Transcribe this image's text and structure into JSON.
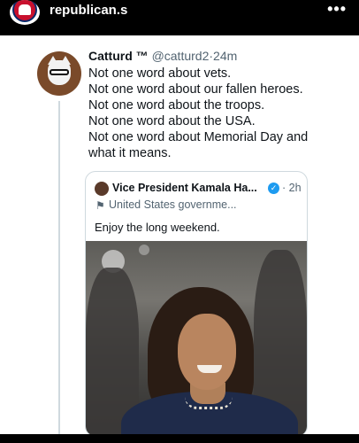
{
  "header": {
    "account_name": "republican.s",
    "more_icon": "more-horizontal-icon",
    "more_label": "•••",
    "logo_icon": "republican-elephant-logo"
  },
  "tweet": {
    "author_name": "Catturd ™",
    "author_handle": "@catturd2",
    "separator": "·",
    "time": "24m",
    "lines": [
      "Not one word about vets.",
      "Not one word about our fallen heroes.",
      "Not one word about the troops.",
      "Not one word about the USA.",
      "Not one word about Memorial Day and",
      "what it means."
    ]
  },
  "quoted_tweet": {
    "author_name": "Vice President Kamala Ha...",
    "verified": true,
    "time": "· 2h",
    "org_label": "United States governme...",
    "flag_icon": "flag-icon",
    "flag_glyph": "⚑",
    "verified_glyph": "✓",
    "text": "Enjoy the long weekend."
  },
  "colors": {
    "text_primary": "#0f1419",
    "text_secondary": "#536471",
    "verified_blue": "#1d9bf0",
    "border": "#cfd9de"
  }
}
